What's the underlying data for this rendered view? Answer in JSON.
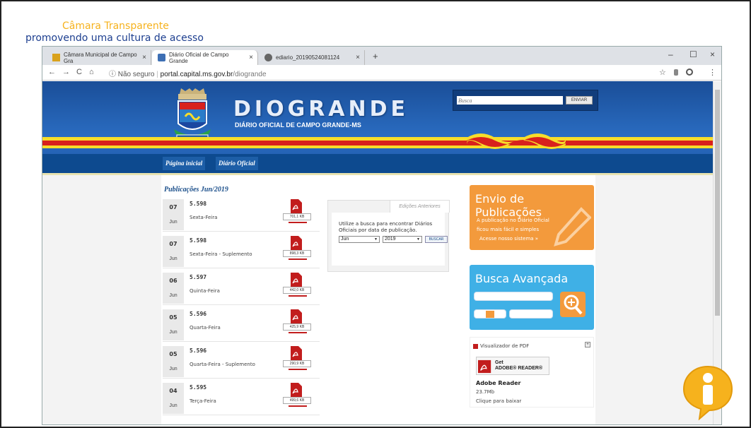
{
  "banner": {
    "title": "Câmara Transparente",
    "subtitle": "promovendo uma cultura de acesso"
  },
  "tabs": [
    {
      "label": "Câmara Municipal de Campo Gra",
      "close": "×"
    },
    {
      "label": "Diário Oficial de Campo Grande",
      "close": "×"
    },
    {
      "label": "ediario_20190524081124",
      "close": "×"
    }
  ],
  "new_tab": "+",
  "window_controls": {
    "minimize": "–",
    "maximize": "☐",
    "close": "×"
  },
  "addressbar": {
    "back": "←",
    "forward": "→",
    "reload": "C",
    "home": "⌂",
    "security": "ⓘ Não seguro",
    "host": "portal.capital.ms.gov.br",
    "path": "/diogrande",
    "star": "☆",
    "menu": "⋮"
  },
  "site": {
    "logo": "DIOGRANDE",
    "logo_sub": "DIÁRIO OFICIAL DE CAMPO GRANDE-MS",
    "search": {
      "placeholder": "Busca",
      "button": "ENVIAR"
    },
    "menu": [
      "Página inicial",
      "Diário Oficial"
    ]
  },
  "publications": {
    "title": "Publicações Jun/2019",
    "items": [
      {
        "day": "07",
        "month": "Jun",
        "number": "5.598",
        "weekday": "Sexta-Feira",
        "size": "701,1 KB"
      },
      {
        "day": "07",
        "month": "Jun",
        "number": "5.598",
        "weekday": "Sexta-Feira - Suplemento",
        "size": "898,3 KB"
      },
      {
        "day": "06",
        "month": "Jun",
        "number": "5.597",
        "weekday": "Quinta-Feira",
        "size": "442,0 KB"
      },
      {
        "day": "05",
        "month": "Jun",
        "number": "5.596",
        "weekday": "Quarta-Feira",
        "size": "425,9 KB"
      },
      {
        "day": "05",
        "month": "Jun",
        "number": "5.596",
        "weekday": "Quarta-Feira - Suplemento",
        "size": "290,9 KB"
      },
      {
        "day": "04",
        "month": "Jun",
        "number": "5.595",
        "weekday": "Terça-Feira",
        "size": "499,6 KB"
      }
    ]
  },
  "editions": {
    "tab": "Edições Anteriores",
    "text": "Utilize a busca para encontrar Diários Oficiais por data de publicação.",
    "month": "Jun",
    "year": "2019",
    "button": "BUSCAR"
  },
  "envio": {
    "title": "Envio de Publicações",
    "line1": "A publicação no Diário Oficial",
    "line2": "ficou mais fácil e simples",
    "line3": "Acesse nosso sistema  »"
  },
  "busca_avancada": {
    "title": "Busca Avançada"
  },
  "pdf_viewer": {
    "title": "Visualizador de PDF",
    "expand": "+",
    "badge_get": "Get",
    "badge_reader": "ADOBE® READER®",
    "name": "Adobe Reader",
    "size": "23.7Mb",
    "download": "Clique para baixar"
  },
  "colors": {
    "header_blue": "#1f59a8",
    "stripe_yellow": "#f7dd2a",
    "stripe_red": "#d8211d",
    "envio_orange": "#f39a3c",
    "busca_blue": "#3fb0e6",
    "pdf_red": "#c21d1d"
  }
}
